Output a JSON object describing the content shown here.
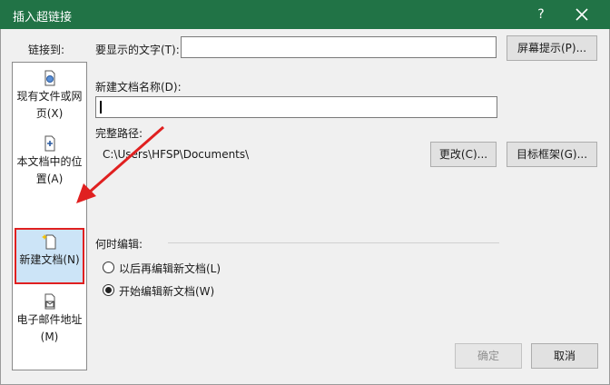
{
  "window": {
    "title": "插入超链接",
    "help_glyph": "?"
  },
  "link_to": {
    "label": "链接到:",
    "items": [
      {
        "label": "现有文件或网页(X)",
        "icon": "web-page-icon"
      },
      {
        "label": "本文档中的位置(A)",
        "icon": "document-place-icon"
      },
      {
        "label": "新建文档(N)",
        "icon": "new-document-icon",
        "selected": true
      },
      {
        "label": "电子邮件地址(M)",
        "icon": "email-icon"
      }
    ]
  },
  "display_text": {
    "label": "要显示的文字(T):",
    "value": "",
    "screen_tip_button": "屏幕提示(P)..."
  },
  "new_doc_name": {
    "label": "新建文档名称(D):",
    "value": ""
  },
  "full_path": {
    "label": "完整路径:",
    "value": "C:\\Users\\HFSP\\Documents\\",
    "change_button": "更改(C)...",
    "target_frame_button": "目标框架(G)..."
  },
  "when_to_edit": {
    "label": "何时编辑:",
    "options": [
      {
        "label": "以后再编辑新文档(L)",
        "selected": false
      },
      {
        "label": "开始编辑新文档(W)",
        "selected": true
      }
    ]
  },
  "footer": {
    "ok_button": "确定",
    "cancel_button": "取消"
  },
  "colors": {
    "titlebar": "#217346",
    "selection": "#cce4f7",
    "annotation_red": "#e02020"
  }
}
